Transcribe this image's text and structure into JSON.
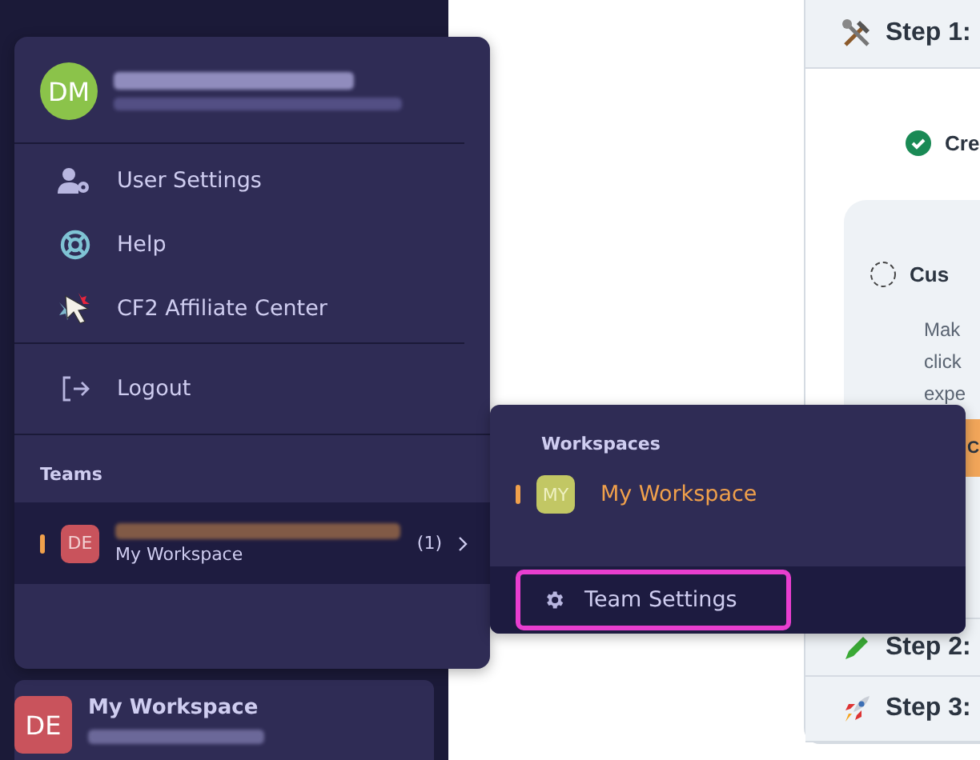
{
  "profile": {
    "initials": "DM"
  },
  "menu": [
    {
      "label": "User Settings",
      "kind": "user-settings"
    },
    {
      "label": "Help",
      "kind": "help"
    },
    {
      "label": "CF2 Affiliate Center",
      "kind": "affiliate"
    }
  ],
  "logout": {
    "label": "Logout"
  },
  "teams": {
    "heading": "Teams",
    "items": [
      {
        "initials": "DE",
        "subtitle": "My Workspace",
        "count": "(1)",
        "selected": true
      }
    ]
  },
  "workspaces": {
    "heading": "Workspaces",
    "items": [
      {
        "initials": "MY",
        "label": "My Workspace",
        "selected": true
      }
    ],
    "team_settings": {
      "label": "Team Settings",
      "highlighted": true
    }
  },
  "current_workspace": {
    "initials": "DE",
    "name": "My Workspace"
  },
  "steps": [
    {
      "label": "Step 1:",
      "kind": "tools"
    },
    {
      "label": "Step 2:",
      "kind": "pencil"
    },
    {
      "label": "Step 3:",
      "kind": "rocket"
    }
  ],
  "tasks": [
    {
      "label": "Cre",
      "done": true
    },
    {
      "label": "Cus",
      "done": false,
      "lines": [
        "Mak",
        "click",
        "expe"
      ],
      "button": "C"
    }
  ]
}
